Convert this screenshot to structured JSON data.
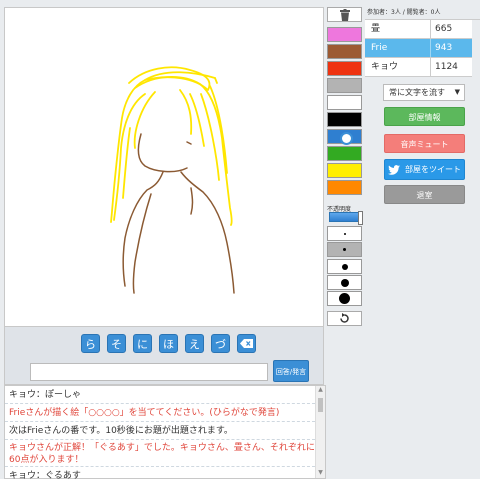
{
  "counts": {
    "text": "参加者：3人 / 閲覧者：0人"
  },
  "players": [
    {
      "name": "畳",
      "score": "665",
      "drawing": false
    },
    {
      "name": "Frie",
      "score": "943",
      "drawing": true
    },
    {
      "name": "キョウ",
      "score": "1124",
      "drawing": false
    }
  ],
  "mode_select": {
    "selected": "常に文字を流す"
  },
  "buttons": {
    "room_info": "部屋情報",
    "mute": "音声ミュート",
    "tweet": "部屋をツイート",
    "exit": "退室",
    "answer_submit": "回答/発言"
  },
  "palette": {
    "colors": [
      "#ee77dd",
      "#9c5a33",
      "#ee3311",
      "#b3b3b3",
      "#ffffff",
      "#000000",
      "#2f7fd0",
      "#33aa22",
      "#ffee00",
      "#ff8800"
    ],
    "selected_index": 6
  },
  "opacity": {
    "label": "不透明度",
    "value": 1.0
  },
  "brush_sizes": {
    "selected_index": 1
  },
  "hint_keys": [
    "ら",
    "そ",
    "に",
    "ほ",
    "え",
    "づ"
  ],
  "answer": {
    "value": "",
    "placeholder": ""
  },
  "chat": [
    {
      "text": "キョウ：ぽーしゃ",
      "type": "user"
    },
    {
      "text": "Frieさんが描く絵「○○○○」を当ててください。(ひらがなで発言)",
      "type": "sys"
    },
    {
      "text": "次はFrieさんの番です。10秒後にお題が出題されます。",
      "type": "info"
    },
    {
      "text": "キョウさんが正解！「ぐるあす」でした。キョウさん、畳さん、それぞれに60点が入ります！",
      "type": "sys2"
    },
    {
      "text": "キョウ：ぐるあす",
      "type": "user"
    }
  ],
  "icons": {
    "trash": "trash-icon",
    "undo": "undo-icon",
    "backspace": "backspace-icon",
    "twitter": "twitter-icon"
  }
}
